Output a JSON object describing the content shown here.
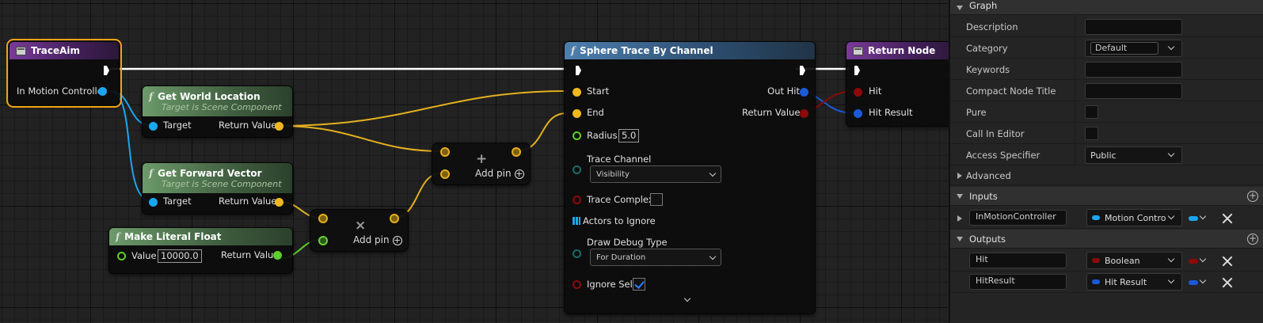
{
  "nodes": {
    "trace_aim": {
      "title": "TraceAim",
      "pin_in_motion_controller": "In Motion Controller"
    },
    "get_world_location": {
      "title": "Get World Location",
      "subtitle": "Target is Scene Component",
      "target": "Target",
      "return_value": "Return Value"
    },
    "get_forward_vector": {
      "title": "Get Forward Vector",
      "subtitle": "Target is Scene Component",
      "target": "Target",
      "return_value": "Return Value"
    },
    "make_literal_float": {
      "title": "Make Literal Float",
      "value_label": "Value",
      "value": "10000.0",
      "return_value": "Return Value"
    },
    "multiply": {
      "symbol": "×",
      "add_pin": "Add pin"
    },
    "add": {
      "symbol": "+",
      "add_pin": "Add pin"
    },
    "sphere_trace": {
      "title": "Sphere Trace By Channel",
      "start": "Start",
      "end": "End",
      "radius_label": "Radius",
      "radius_value": "5.0",
      "trace_channel_label": "Trace Channel",
      "trace_channel_value": "Visibility",
      "trace_complex_label": "Trace Complex",
      "actors_to_ignore_label": "Actors to Ignore",
      "draw_debug_type_label": "Draw Debug Type",
      "draw_debug_type_value": "For Duration",
      "ignore_self_label": "Ignore Self",
      "out_hit": "Out Hit",
      "return_value": "Return Value"
    },
    "return_node": {
      "title": "Return Node",
      "hit": "Hit",
      "hit_result": "Hit Result"
    }
  },
  "panel": {
    "graph_section": "Graph",
    "rows": {
      "description": "Description",
      "category": "Category",
      "category_value": "Default",
      "keywords": "Keywords",
      "compact_node_title": "Compact Node Title",
      "pure": "Pure",
      "call_in_editor": "Call In Editor",
      "access_specifier": "Access Specifier",
      "access_specifier_value": "Public"
    },
    "advanced_section": "Advanced",
    "inputs_section": "Inputs",
    "inputs": [
      {
        "name": "InMotionController",
        "type": "Motion Contro",
        "color": "#1aa6f0"
      }
    ],
    "outputs_section": "Outputs",
    "outputs": [
      {
        "name": "Hit",
        "type": "Boolean",
        "color": "#8c0a0a"
      },
      {
        "name": "HitResult",
        "type": "Hit Result",
        "color": "#1a5ad8"
      }
    ]
  },
  "colors": {
    "exec": "#ffffff",
    "vector": "#f0b81e",
    "object": "#1aa6f0",
    "float": "#5ccf2a",
    "boolean": "#8c0a0a",
    "struct": "#1a5ad8",
    "selection": "#f0a215"
  }
}
